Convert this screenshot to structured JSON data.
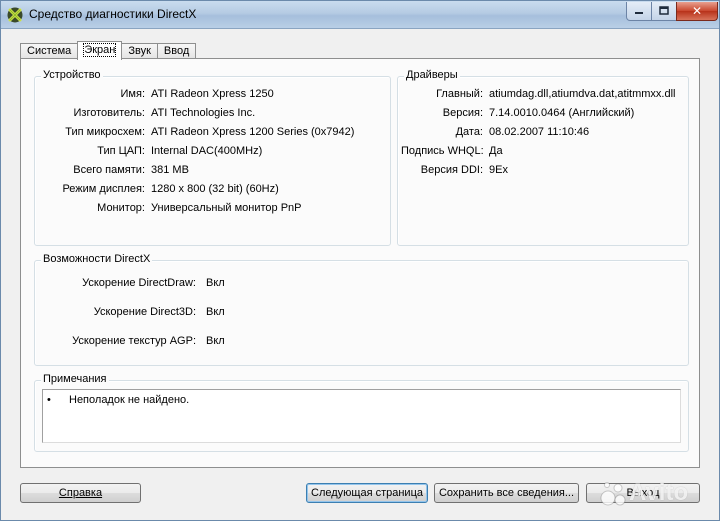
{
  "window": {
    "title": "Средство диагностики DirectX"
  },
  "titlebar_buttons": {
    "close": "✕"
  },
  "tabs": [
    {
      "label": "Система",
      "active": false
    },
    {
      "label": "Экран",
      "active": true
    },
    {
      "label": "Звук",
      "active": false
    },
    {
      "label": "Ввод",
      "active": false
    }
  ],
  "device": {
    "title": "Устройство",
    "rows": [
      {
        "label": "Имя:",
        "value": "ATI Radeon Xpress 1250"
      },
      {
        "label": "Изготовитель:",
        "value": "ATI Technologies Inc."
      },
      {
        "label": "Тип микросхем:",
        "value": "ATI Radeon Xpress 1200 Series (0x7942)"
      },
      {
        "label": "Тип ЦАП:",
        "value": "Internal DAC(400MHz)"
      },
      {
        "label": "Всего памяти:",
        "value": "381 MB"
      },
      {
        "label": "Режим дисплея:",
        "value": "1280 x 800 (32 bit) (60Hz)"
      },
      {
        "label": "Монитор:",
        "value": "Универсальный монитор PnP"
      }
    ]
  },
  "drivers": {
    "title": "Драйверы",
    "rows": [
      {
        "label": "Главный:",
        "value": "atiumdag.dll,atiumdva.dat,atitmmxx.dll"
      },
      {
        "label": "Версия:",
        "value": "7.14.0010.0464 (Английский)"
      },
      {
        "label": "Дата:",
        "value": "08.02.2007 11:10:46"
      },
      {
        "label": "Подпись WHQL:",
        "value": "Да"
      },
      {
        "label": "Версия DDI:",
        "value": "9Ex"
      }
    ]
  },
  "features": {
    "title": "Возможности DirectX",
    "rows": [
      {
        "label": "Ускорение DirectDraw:",
        "value": "Вкл"
      },
      {
        "label": "Ускорение Direct3D:",
        "value": "Вкл"
      },
      {
        "label": "Ускорение текстур AGP:",
        "value": "Вкл"
      }
    ]
  },
  "notes": {
    "title": "Примечания",
    "bullet": "•",
    "items": [
      "Неполадок не найдено."
    ]
  },
  "buttons": {
    "help": "Справка",
    "next_page": "Следующая страница",
    "save_all": "Сохранить все сведения...",
    "exit": "Выход"
  },
  "watermark": {
    "text": "Avito"
  },
  "colors": {
    "titlebar": "#b5cbe3",
    "close_button": "#c9462d",
    "default_button_border": "#3c7fb1",
    "watermark": "#ffffff"
  }
}
